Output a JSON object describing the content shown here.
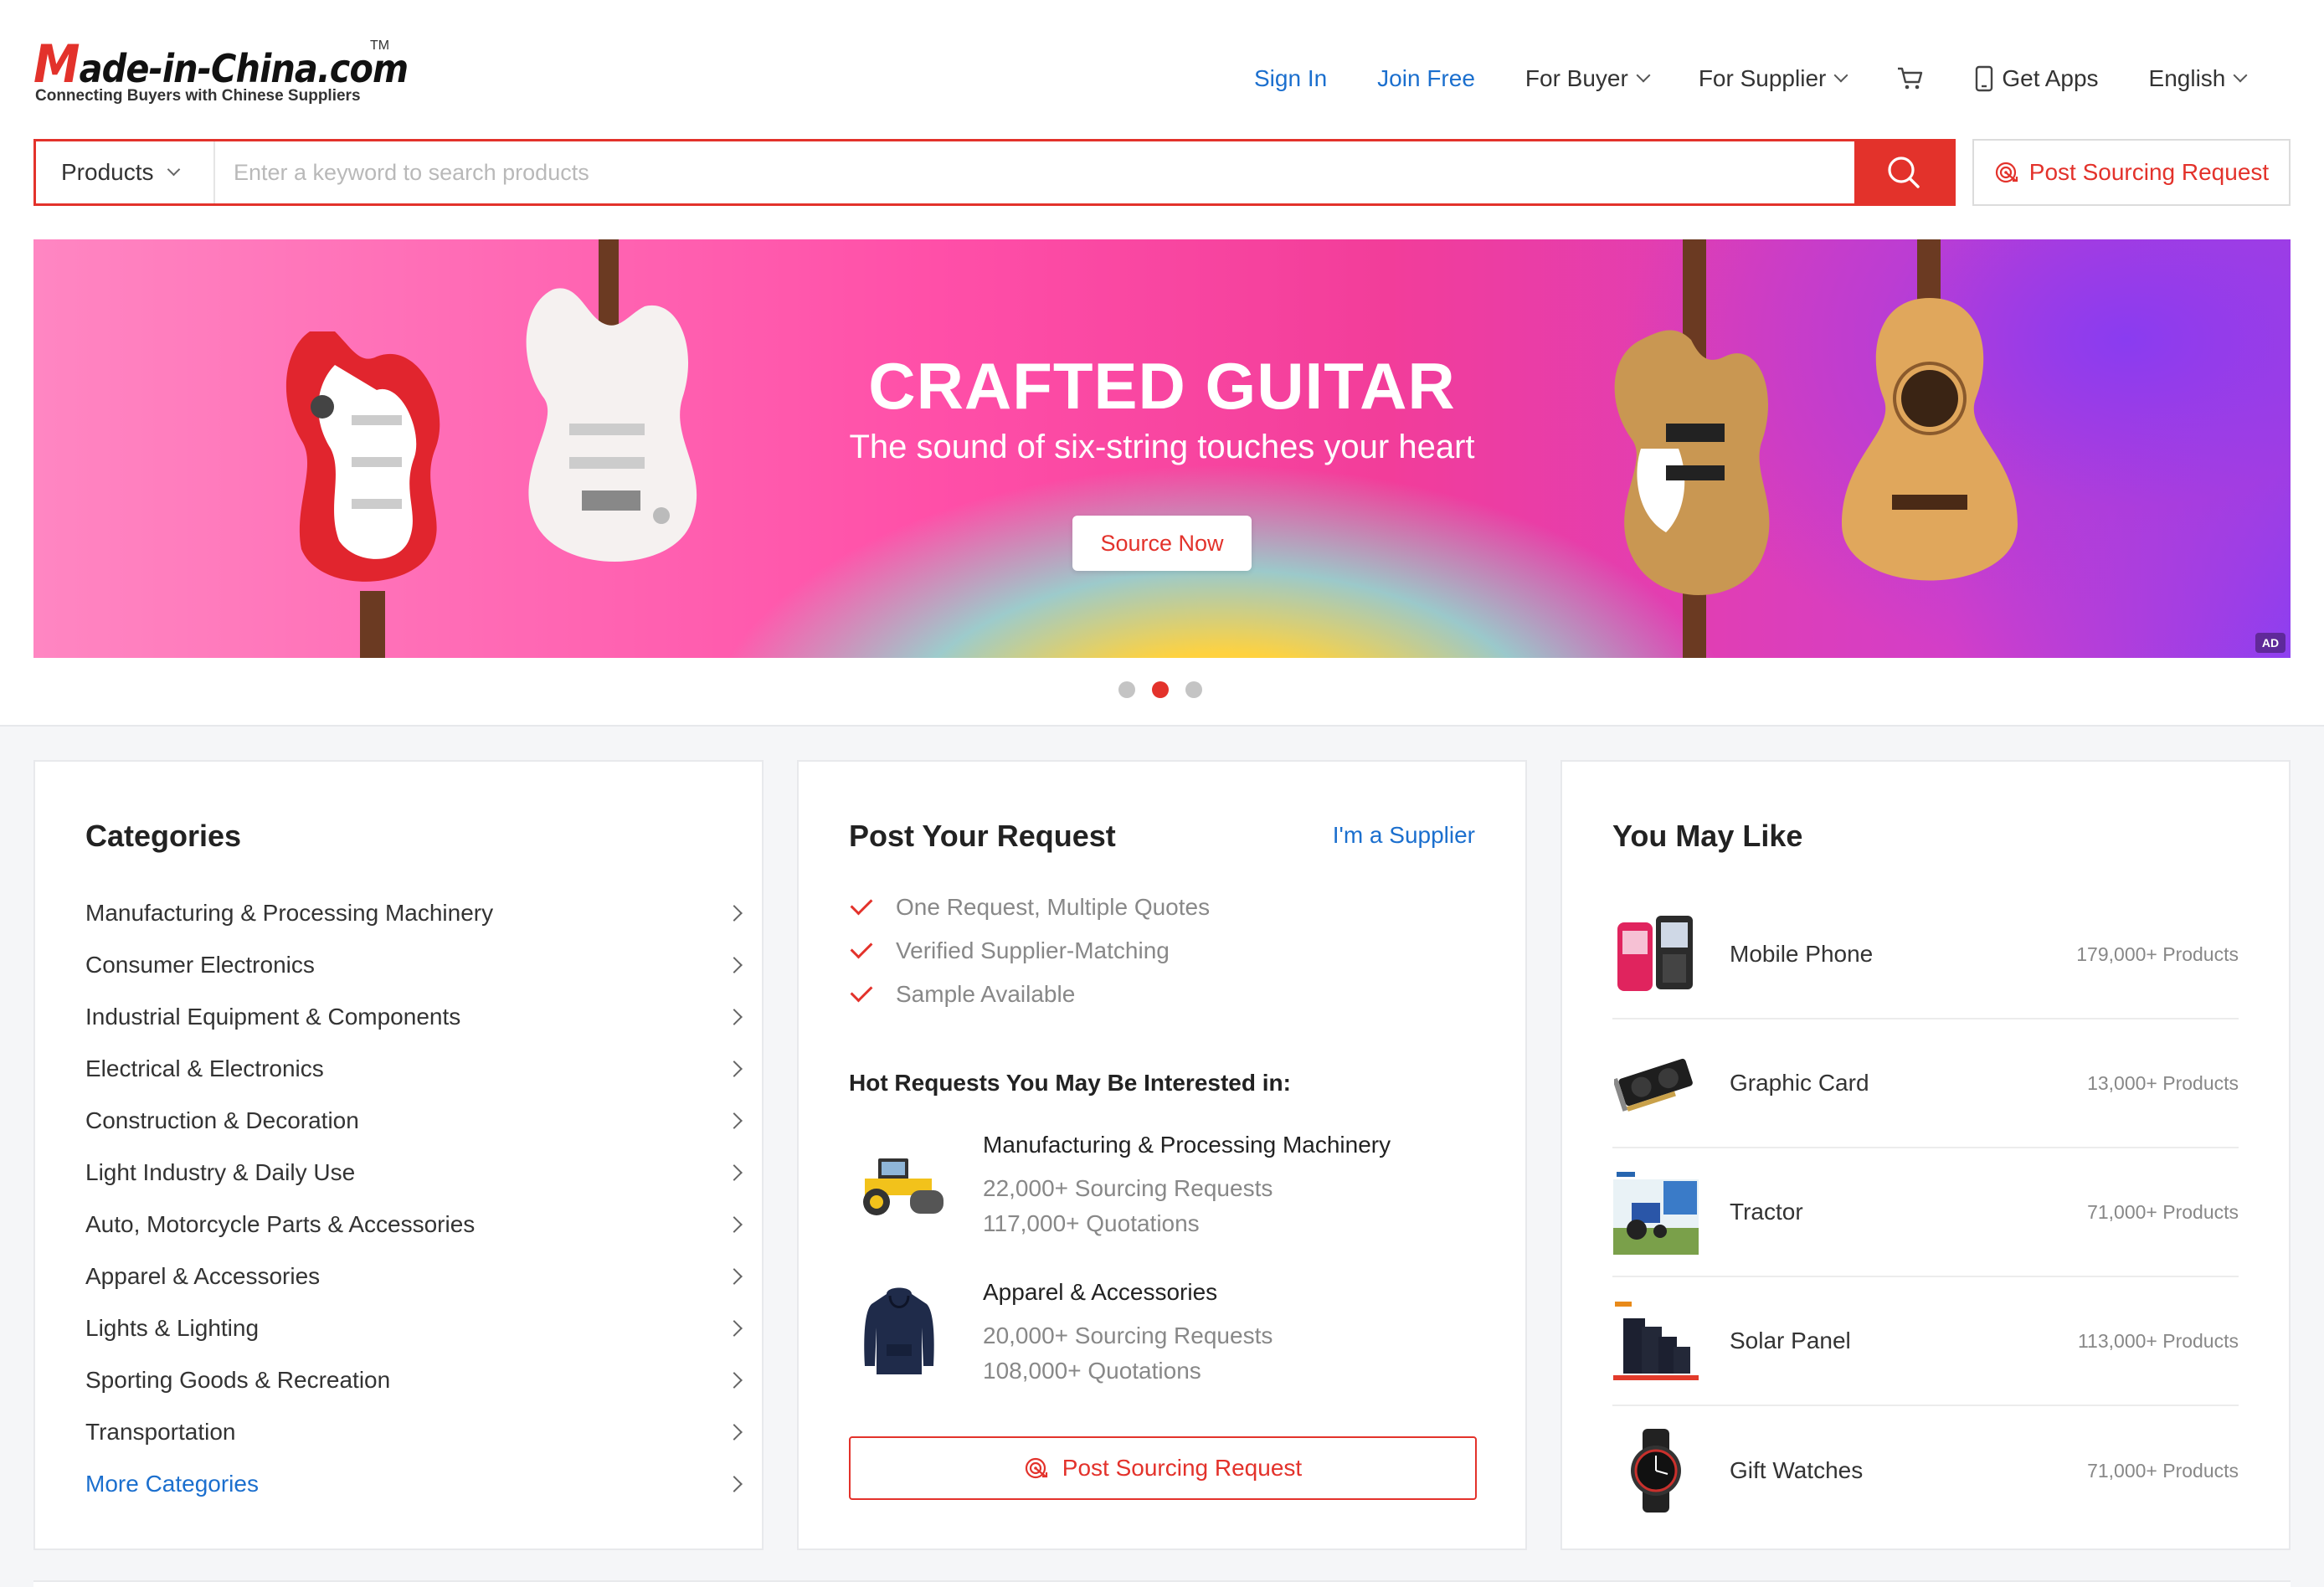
{
  "logo": {
    "letter": "M",
    "rest": "ade-in-China.com",
    "tm": "TM",
    "tagline": "Connecting Buyers with Chinese Suppliers"
  },
  "nav": {
    "sign_in": "Sign In",
    "join_free": "Join Free",
    "for_buyer": "For Buyer",
    "for_supplier": "For Supplier",
    "get_apps": "Get Apps",
    "language": "English"
  },
  "search": {
    "category": "Products",
    "placeholder": "Enter a keyword to search products",
    "value": ""
  },
  "post_request_label": "Post Sourcing Request",
  "banner": {
    "title": "CRAFTED GUITAR",
    "subtitle": "The sound of six-string touches your heart",
    "cta": "Source Now",
    "ad": "AD"
  },
  "categories": {
    "title": "Categories",
    "items": [
      "Manufacturing & Processing Machinery",
      "Consumer Electronics",
      "Industrial Equipment & Components",
      "Electrical & Electronics",
      "Construction & Decoration",
      "Light Industry & Daily Use",
      "Auto, Motorcycle Parts & Accessories",
      "Apparel & Accessories",
      "Lights & Lighting",
      "Sporting Goods & Recreation",
      "Transportation"
    ],
    "more": "More Categories"
  },
  "request": {
    "title": "Post Your Request",
    "supplier_link": "I'm a Supplier",
    "benefits": [
      "One Request, Multiple Quotes",
      "Verified Supplier-Matching",
      "Sample Available"
    ],
    "hot_title": "Hot Requests You May Be Interested in:",
    "hot": [
      {
        "name": "Manufacturing & Processing Machinery",
        "requests": "22,000+ Sourcing Requests",
        "quotes": "117,000+ Quotations"
      },
      {
        "name": "Apparel & Accessories",
        "requests": "20,000+ Sourcing Requests",
        "quotes": "108,000+ Quotations"
      }
    ],
    "button": "Post Sourcing Request"
  },
  "like": {
    "title": "You May Like",
    "items": [
      {
        "name": "Mobile Phone",
        "count": "179,000+ Products"
      },
      {
        "name": "Graphic Card",
        "count": "13,000+ Products"
      },
      {
        "name": "Tractor",
        "count": "71,000+ Products"
      },
      {
        "name": "Solar Panel",
        "count": "113,000+ Products"
      },
      {
        "name": "Gift Watches",
        "count": "71,000+ Products"
      }
    ]
  },
  "colors": {
    "brand_red": "#e3322b",
    "link_blue": "#1b6fce"
  }
}
